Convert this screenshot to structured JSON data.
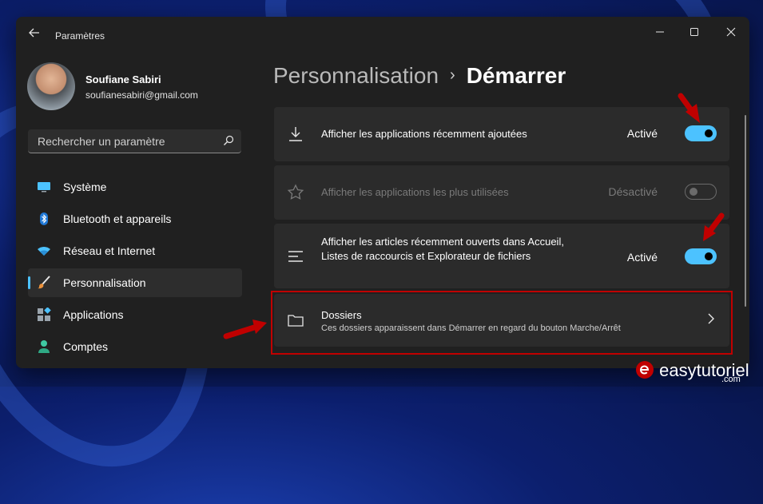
{
  "window": {
    "title": "Paramètres"
  },
  "user": {
    "name": "Soufiane Sabiri",
    "email": "soufianesabiri@gmail.com"
  },
  "search": {
    "placeholder": "Rechercher un paramètre"
  },
  "sidebar": {
    "items": [
      {
        "label": "Système",
        "icon": "monitor-icon"
      },
      {
        "label": "Bluetooth et appareils",
        "icon": "bluetooth-icon"
      },
      {
        "label": "Réseau et Internet",
        "icon": "wifi-icon"
      },
      {
        "label": "Personnalisation",
        "icon": "brush-icon",
        "active": true
      },
      {
        "label": "Applications",
        "icon": "apps-icon"
      },
      {
        "label": "Comptes",
        "icon": "person-icon"
      }
    ]
  },
  "breadcrumb": {
    "parent": "Personnalisation",
    "separator": "›",
    "current": "Démarrer"
  },
  "settings": {
    "recent_apps": {
      "label": "Afficher les applications récemment ajoutées",
      "state": "Activé",
      "on": true
    },
    "most_used": {
      "label": "Afficher les applications les plus utilisées",
      "state": "Désactivé",
      "on": false
    },
    "recent_items": {
      "label": "Afficher les articles récemment ouverts dans Accueil, Listes de raccourcis et Explorateur de fichiers",
      "state": "Activé",
      "on": true
    },
    "folders": {
      "label": "Dossiers",
      "description": "Ces dossiers apparaissent dans Démarrer en regard du bouton Marche/Arrêt"
    }
  },
  "colors": {
    "accent": "#4cc2ff",
    "annotation": "#c00000"
  },
  "watermark": {
    "brand": "easytutoriel",
    "tld": ".com"
  }
}
